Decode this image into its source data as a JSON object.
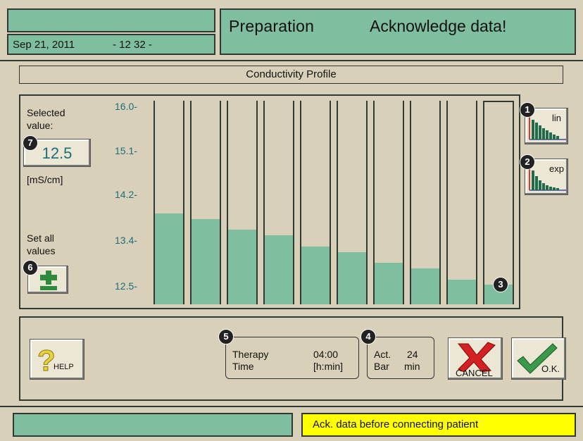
{
  "header": {
    "date": "Sep 21, 2011",
    "time": "- 12 32 -",
    "mode": "Preparation",
    "message": "Acknowledge data!"
  },
  "profile": {
    "title": "Conductivity Profile",
    "selected_label_line1": "Selected",
    "selected_label_line2": "value:",
    "selected_value": "12.5",
    "unit": "[mS/cm]",
    "set_all_line1": "Set all",
    "set_all_line2": "values",
    "y_ticks": [
      "16.0-",
      "15.1-",
      "14.2-",
      "13.4-",
      "12.5-"
    ],
    "bar_values": [
      14.0,
      13.9,
      13.7,
      13.6,
      13.4,
      13.3,
      13.1,
      13.0,
      12.8,
      12.7
    ],
    "lin_label": "lin",
    "exp_label": "exp"
  },
  "markers": [
    "1",
    "2",
    "3",
    "4",
    "5",
    "6",
    "7"
  ],
  "footer": {
    "help_label": "HELP",
    "therapy_label1": "Therapy",
    "therapy_label2": "Time",
    "therapy_value": "04:00",
    "therapy_unit": "[h:min]",
    "act_label1": "Act.",
    "act_label2": "Bar",
    "act_value": "24",
    "act_unit": "min",
    "cancel_label": "CANCEL",
    "ok_label": "O.K."
  },
  "status": {
    "left_text": "",
    "right_text": "Ack. data before connecting patient"
  },
  "colors": {
    "accent_green": "#7fbf9f",
    "background": "#d8d0b8",
    "teal_text": "#1c6e7a",
    "warning_yellow": "#ffff00"
  }
}
